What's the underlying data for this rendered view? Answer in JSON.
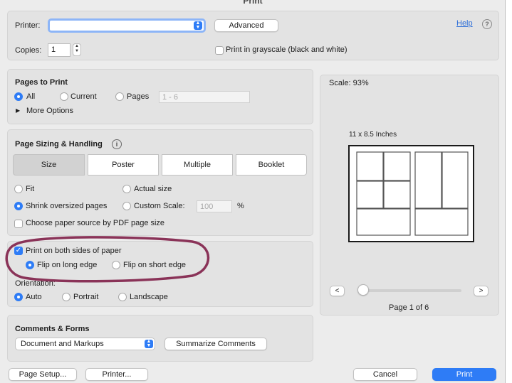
{
  "window": {
    "title": "Print"
  },
  "header": {
    "printer_label": "Printer:",
    "printer_value": "",
    "advanced_label": "Advanced",
    "help_label": "Help",
    "help_icon": "?",
    "copies_label": "Copies:",
    "copies_value": "1",
    "grayscale_label": "Print in grayscale (black and white)"
  },
  "pages_to_print": {
    "heading": "Pages to Print",
    "all_label": "All",
    "current_label": "Current",
    "pages_label": "Pages",
    "pages_placeholder": "1 - 6",
    "more_options_label": "More Options",
    "selected": "All"
  },
  "sizing": {
    "heading": "Page Sizing & Handling",
    "info_icon": "i",
    "tabs": [
      "Size",
      "Poster",
      "Multiple",
      "Booklet"
    ],
    "selected_tab": "Size",
    "fit_label": "Fit",
    "actual_label": "Actual size",
    "shrink_label": "Shrink oversized pages",
    "custom_label": "Custom Scale:",
    "custom_value": "100",
    "percent": "%",
    "paper_source_label": "Choose paper source by PDF page size"
  },
  "duplex": {
    "both_sides_label": "Print on both sides of paper",
    "long_edge_label": "Flip on long edge",
    "short_edge_label": "Flip on short edge"
  },
  "orientation": {
    "heading": "Orientation:",
    "auto_label": "Auto",
    "portrait_label": "Portrait",
    "landscape_label": "Landscape"
  },
  "comments": {
    "heading": "Comments & Forms",
    "select_value": "Document and Markups",
    "summarize_label": "Summarize Comments"
  },
  "preview": {
    "scale_label": "Scale:  93%",
    "paper_size": "11 x 8.5 Inches",
    "prev": "<",
    "next": ">",
    "slider_value": 0,
    "page_indicator": "Page 1 of 6"
  },
  "footer": {
    "page_setup_label": "Page Setup...",
    "printer_label": "Printer...",
    "cancel_label": "Cancel",
    "print_label": "Print"
  },
  "colors": {
    "accent": "#2e7cf6",
    "annotation": "#8a3358"
  }
}
